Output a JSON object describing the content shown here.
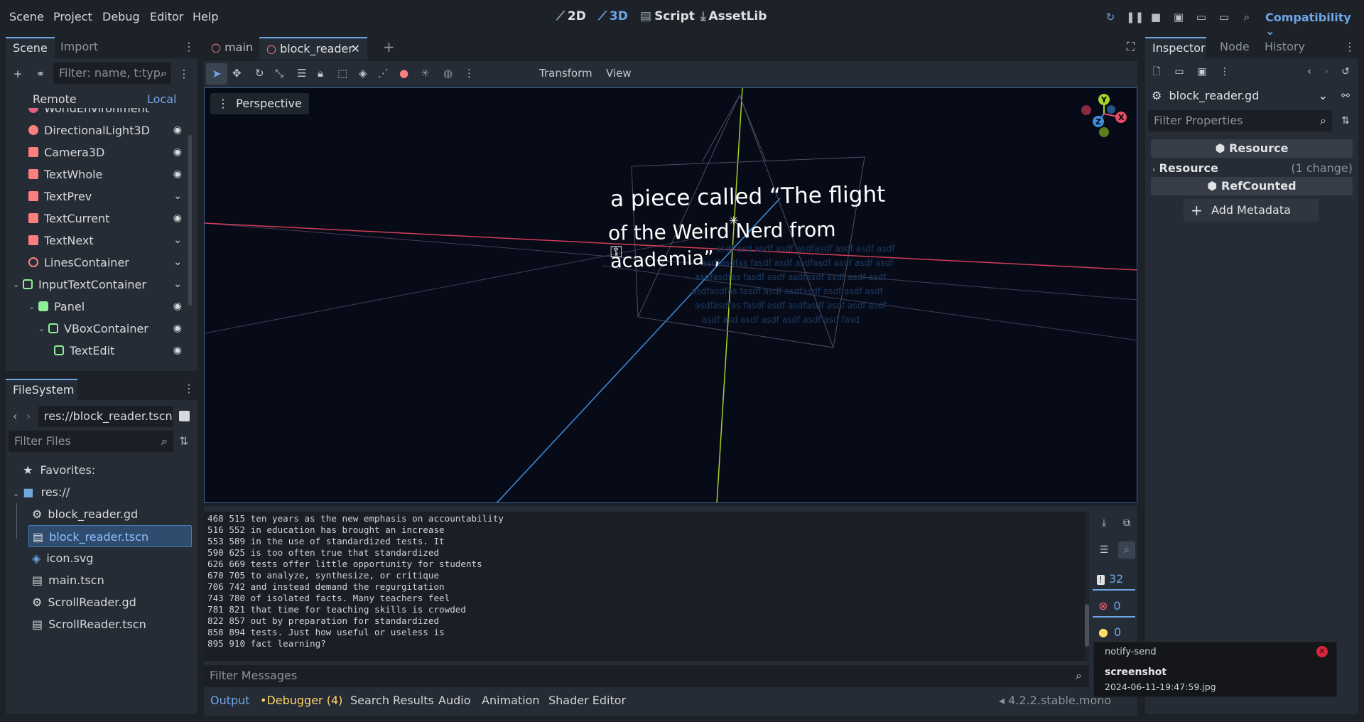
{
  "menubar": {
    "items": [
      "Scene",
      "Project",
      "Debug",
      "Editor",
      "Help"
    ],
    "modes": [
      "2D",
      "3D",
      "Script",
      "AssetLib"
    ],
    "renderer": "Compatibility"
  },
  "scene_dock": {
    "tabs": [
      "Scene",
      "Import"
    ],
    "filter_placeholder": "Filter: name, t:typ",
    "remote": "Remote",
    "local": "Local",
    "nodes": [
      {
        "name": "WorldEnvironment",
        "color": "#e0607e",
        "visible": false
      },
      {
        "name": "DirectionalLight3D",
        "color": "#fc7f7f",
        "visible": true
      },
      {
        "name": "Camera3D",
        "color": "#fc7f7f",
        "visible": true
      },
      {
        "name": "TextWhole",
        "color": "#fc7f7f",
        "visible": true
      },
      {
        "name": "TextPrev",
        "color": "#fc7f7f",
        "visible": false
      },
      {
        "name": "TextCurrent",
        "color": "#fc7f7f",
        "visible": true
      },
      {
        "name": "TextNext",
        "color": "#fc7f7f",
        "visible": false
      },
      {
        "name": "LinesContainer",
        "color": "#fc7f7f",
        "visible": false
      },
      {
        "name": "InputTextContainer",
        "color": "#8eef97",
        "visible": false
      },
      {
        "name": "Panel",
        "color": "#8eef97",
        "visible": true
      },
      {
        "name": "VBoxContainer",
        "color": "#8eef97",
        "visible": true
      },
      {
        "name": "TextEdit",
        "color": "#8eef97",
        "visible": true
      }
    ]
  },
  "filesystem": {
    "tab": "FileSystem",
    "path": "res://block_reader.tscn",
    "filter_placeholder": "Filter Files",
    "favorites": "Favorites:",
    "root": "res://",
    "files": [
      "block_reader.gd",
      "block_reader.tscn",
      "icon.svg",
      "main.tscn",
      "ScrollReader.gd",
      "ScrollReader.tscn"
    ]
  },
  "editor_tabs": [
    "main",
    "block_reader"
  ],
  "viewport": {
    "toolbar": [
      "Transform",
      "View"
    ],
    "perspective": "Perspective",
    "text_line1": "a piece called “The flight",
    "text_line2": "of the Weird Nerd from",
    "text_line3": "academia”,",
    "gizmo": [
      "Y",
      "Z",
      "X"
    ]
  },
  "output": {
    "lines": [
      "468 515 ten years as the new emphasis on accountability",
      "516 552 in education has brought an increase",
      "553 589 in the use of standardized tests. It",
      "590 625 is too often true that standardized",
      "626 669 tests offer little opportunity for students",
      "670 705 to analyze, synthesize, or critique",
      "706 742 and instead demand the regurgitation",
      "743 780 of isolated facts. Many teachers feel",
      "781 821 that time for teaching skills is crowded",
      "822 857 out by preparation for standardized",
      "858 894 tests. Just how useful or useless is",
      "895 910 fact learning?"
    ],
    "filter_placeholder": "Filter Messages",
    "counts": {
      "messages": "32",
      "errors": "0",
      "warnings": "0"
    }
  },
  "bottom_tabs": [
    "Output",
    "Debugger (4)",
    "Search Results",
    "Audio",
    "Animation",
    "Shader Editor"
  ],
  "version": "4.2.2.stable.mono",
  "inspector": {
    "tabs": [
      "Inspector",
      "Node",
      "History"
    ],
    "resource": "block_reader.gd",
    "filter_placeholder": "Filter Properties",
    "section1": "Resource",
    "row_label": "Resource",
    "row_value": "(1 change)",
    "section2": "RefCounted",
    "add_metadata": "Add Metadata"
  },
  "notification": {
    "app": "notify-send",
    "title": "screenshot",
    "body": "2024-06-11-19:47:59.jpg"
  }
}
